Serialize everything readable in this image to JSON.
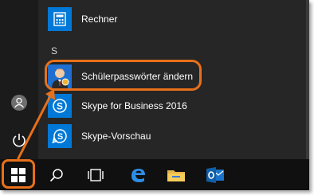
{
  "start_menu": {
    "apps": [
      {
        "label": "Rechner",
        "icon": "calculator-icon",
        "tile_color": "#0078d7"
      },
      {
        "label": "Schülerpasswörter ändern",
        "icon": "user-avatar-icon",
        "tile_color": "#1e6fd0"
      },
      {
        "label": "Skype for Business 2016",
        "icon": "skype-icon",
        "tile_color": "#0078d7"
      },
      {
        "label": "Skype-Vorschau",
        "icon": "skype-icon",
        "tile_color": "#0078d7"
      }
    ],
    "section_letter": "S",
    "rail": [
      "user-account-icon",
      "power-icon"
    ]
  },
  "taskbar": {
    "items": [
      "windows-start-icon",
      "search-icon",
      "task-view-icon",
      "edge-icon",
      "file-explorer-icon",
      "outlook-icon"
    ]
  },
  "colors": {
    "accent": "#0078d7",
    "highlight": "#e8701a",
    "background": "#262626",
    "taskbar": "#101010"
  }
}
